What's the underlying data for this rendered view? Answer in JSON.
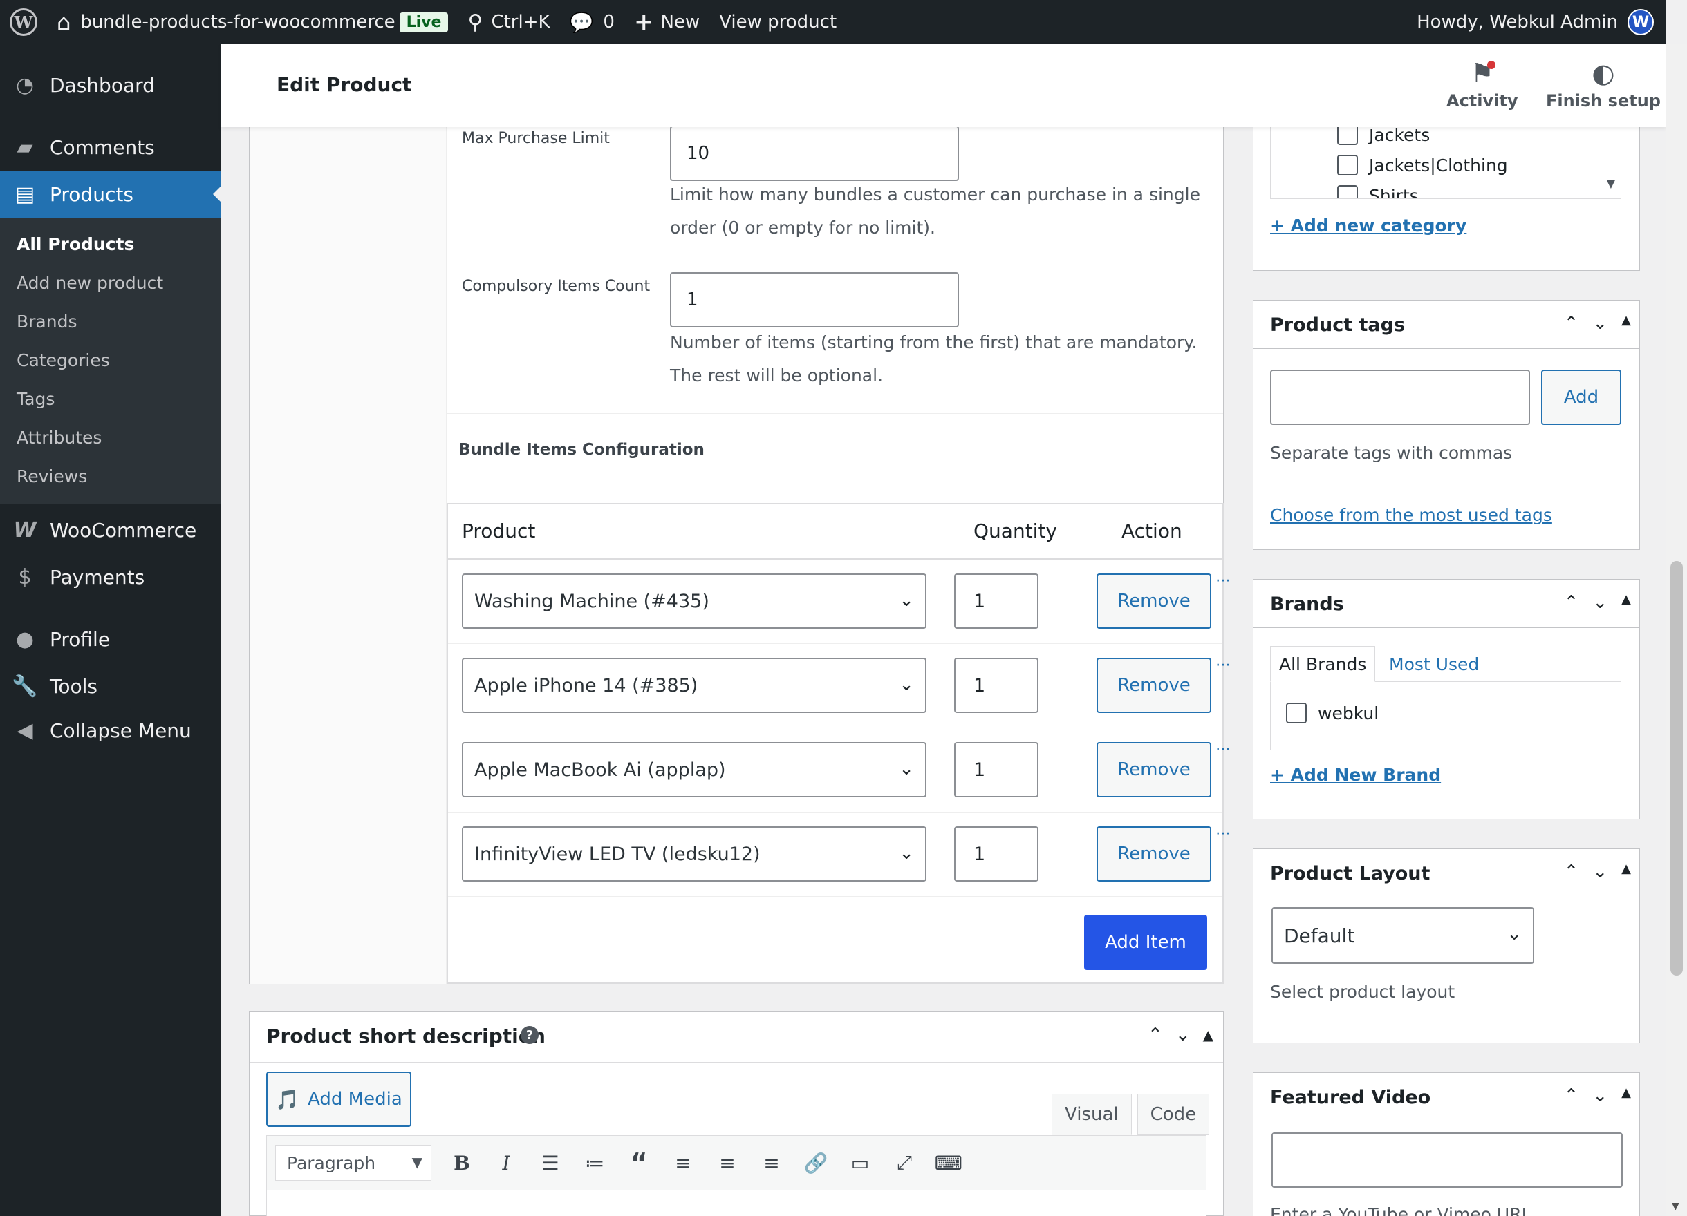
{
  "adminbar": {
    "site_name": "bundle-products-for-woocommerce",
    "live_badge": "Live",
    "search_shortcut": "Ctrl+K",
    "comments_count": "0",
    "new_label": "New",
    "view_product": "View product",
    "howdy": "Howdy, Webkul Admin"
  },
  "sidebar": {
    "dashboard": "Dashboard",
    "comments": "Comments",
    "products": "Products",
    "submenu": [
      "All Products",
      "Add new product",
      "Brands",
      "Categories",
      "Tags",
      "Attributes",
      "Reviews"
    ],
    "woocommerce": "WooCommerce",
    "payments": "Payments",
    "profile": "Profile",
    "tools": "Tools",
    "collapse": "Collapse Menu"
  },
  "header": {
    "title": "Edit Product",
    "activity": "Activity",
    "finish_setup": "Finish setup"
  },
  "bundle": {
    "max_purchase_label": "Max Purchase Limit",
    "max_purchase_value": "10",
    "max_purchase_help_1": "Limit how many bundles a customer can purchase in a single",
    "max_purchase_help_2": "order (0 or empty for no limit).",
    "compulsory_label": "Compulsory Items Count",
    "compulsory_value": "1",
    "compulsory_help_1": "Number of items (starting from the first) that are mandatory.",
    "compulsory_help_2": "The rest will be optional.",
    "config_title": "Bundle Items Configuration",
    "columns": {
      "product": "Product",
      "quantity": "Quantity",
      "action": "Action"
    },
    "items": [
      {
        "product": "Washing Machine (#435)",
        "qty": "1",
        "action": "Remove"
      },
      {
        "product": "Apple iPhone 14 (#385)",
        "qty": "1",
        "action": "Remove"
      },
      {
        "product": "Apple MacBook Ai (applap)",
        "qty": "1",
        "action": "Remove"
      },
      {
        "product": "InfinityView LED TV (ledsku12)",
        "qty": "1",
        "action": "Remove"
      }
    ],
    "add_item": "Add Item"
  },
  "short_description": {
    "title": "Product short description",
    "add_media": "Add Media",
    "tab_visual": "Visual",
    "tab_code": "Code",
    "format_select": "Paragraph"
  },
  "categories": {
    "items": [
      "Jackets",
      "Jackets|Clothing",
      "Shirts"
    ],
    "add_new": "+ Add new category"
  },
  "tags": {
    "title": "Product tags",
    "input_value": "",
    "add_button": "Add",
    "hint": "Separate tags with commas",
    "choose_link": "Choose from the most used tags"
  },
  "brands": {
    "title": "Brands",
    "tab_all": "All Brands",
    "tab_most_used": "Most Used",
    "items": [
      "webkul"
    ],
    "add_new": "+ Add New Brand"
  },
  "layout": {
    "title": "Product Layout",
    "selected": "Default",
    "hint": "Select product layout"
  },
  "video": {
    "title": "Featured Video",
    "input_value": "",
    "hint": "Enter a YouTube or Vimeo URL"
  }
}
